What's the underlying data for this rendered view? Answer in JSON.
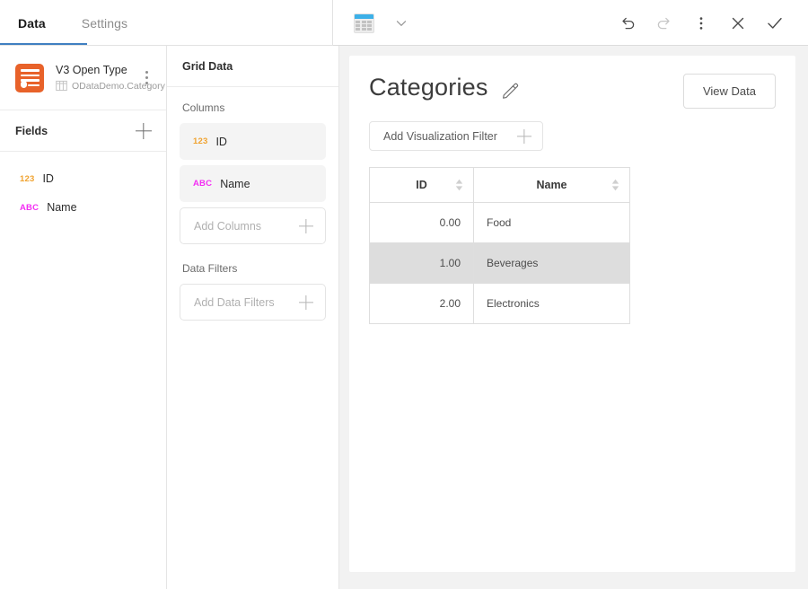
{
  "tabs": [
    {
      "label": "Data",
      "active": true
    },
    {
      "label": "Settings",
      "active": false
    }
  ],
  "toolbar": {
    "chart_type_icon": "grid-table-icon",
    "chart_type_chevron": "chevron-down-icon",
    "undo_icon": "undo-icon",
    "redo_icon": "redo-icon",
    "more_icon": "kebab-menu-icon",
    "close_icon": "close-icon",
    "confirm_icon": "checkmark-icon"
  },
  "source": {
    "icon": "data-source-icon",
    "title": "V3 Open Type",
    "entity_icon": "table-icon",
    "entity": "ODataDemo.Category",
    "menu_icon": "kebab-menu-icon"
  },
  "fields_panel": {
    "title": "Fields",
    "add_icon": "plus-icon",
    "items": [
      {
        "type": "123",
        "type_kind": "num",
        "label": "ID"
      },
      {
        "type": "ABC",
        "type_kind": "str",
        "label": "Name"
      }
    ]
  },
  "grid_data_panel": {
    "title": "Grid Data",
    "columns_label": "Columns",
    "columns": [
      {
        "type": "123",
        "type_kind": "num",
        "label": "ID"
      },
      {
        "type": "ABC",
        "type_kind": "str",
        "label": "Name"
      }
    ],
    "add_columns_label": "Add Columns",
    "add_columns_icon": "plus-icon",
    "data_filters_label": "Data Filters",
    "add_data_filters_label": "Add Data Filters",
    "add_data_filters_icon": "plus-icon"
  },
  "main": {
    "title": "Categories",
    "edit_icon": "pencil-icon",
    "view_data_label": "View Data",
    "add_visualization_filter_label": "Add Visualization Filter",
    "add_visualization_filter_icon": "plus-icon"
  },
  "table": {
    "columns": [
      {
        "label": "ID",
        "align": "right",
        "sort_icon": "sort-arrows-icon"
      },
      {
        "label": "Name",
        "align": "left",
        "sort_icon": "sort-arrows-icon"
      }
    ],
    "rows": [
      {
        "id": "0.00",
        "name": "Food",
        "selected": false
      },
      {
        "id": "1.00",
        "name": "Beverages",
        "selected": true
      },
      {
        "id": "2.00",
        "name": "Electronics",
        "selected": false
      }
    ]
  },
  "colors": {
    "accent_blue": "#3f7fc1",
    "source_orange": "#e8622a",
    "numeric_type": "#f0a330",
    "string_type": "#f32ef3",
    "icon_blue": "#3cb0e8",
    "row_selected": "#dddddd",
    "page_background": "#f2f2f2"
  }
}
